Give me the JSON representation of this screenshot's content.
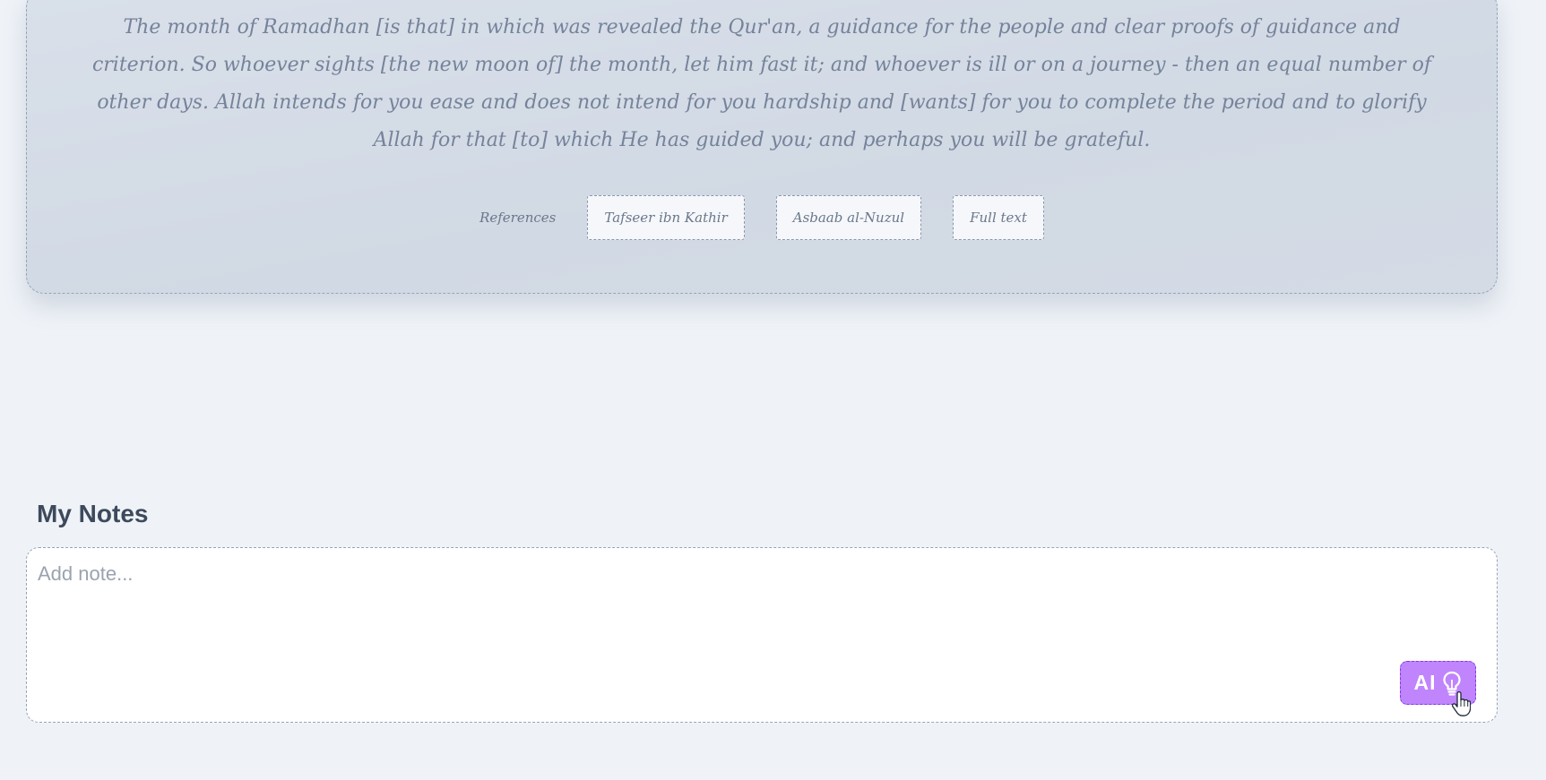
{
  "verse": {
    "text": "The month of Ramadhan [is that] in which was revealed the Qur'an, a guidance for the people and clear proofs of guidance and criterion. So whoever sights [the new moon of] the month, let him fast it; and whoever is ill or on a journey - then an equal number of other days. Allah intends for you ease and does not intend for you hardship and [wants] for you to complete the period and to glorify Allah for that [to] which He has guided you; and perhaps you will be grateful."
  },
  "references": {
    "label": "References",
    "buttons": [
      {
        "label": "Tafseer ibn Kathir"
      },
      {
        "label": "Asbaab al-Nuzul"
      },
      {
        "label": "Full text"
      }
    ]
  },
  "notes": {
    "title": "My Notes",
    "placeholder": "Add note...",
    "value": "",
    "ai_button_label": "AI",
    "ai_button_icon": "lightbulb-icon"
  },
  "colors": {
    "background": "#eff3f8",
    "card": "#d4dbe5",
    "ai_button": "#c084fc"
  }
}
